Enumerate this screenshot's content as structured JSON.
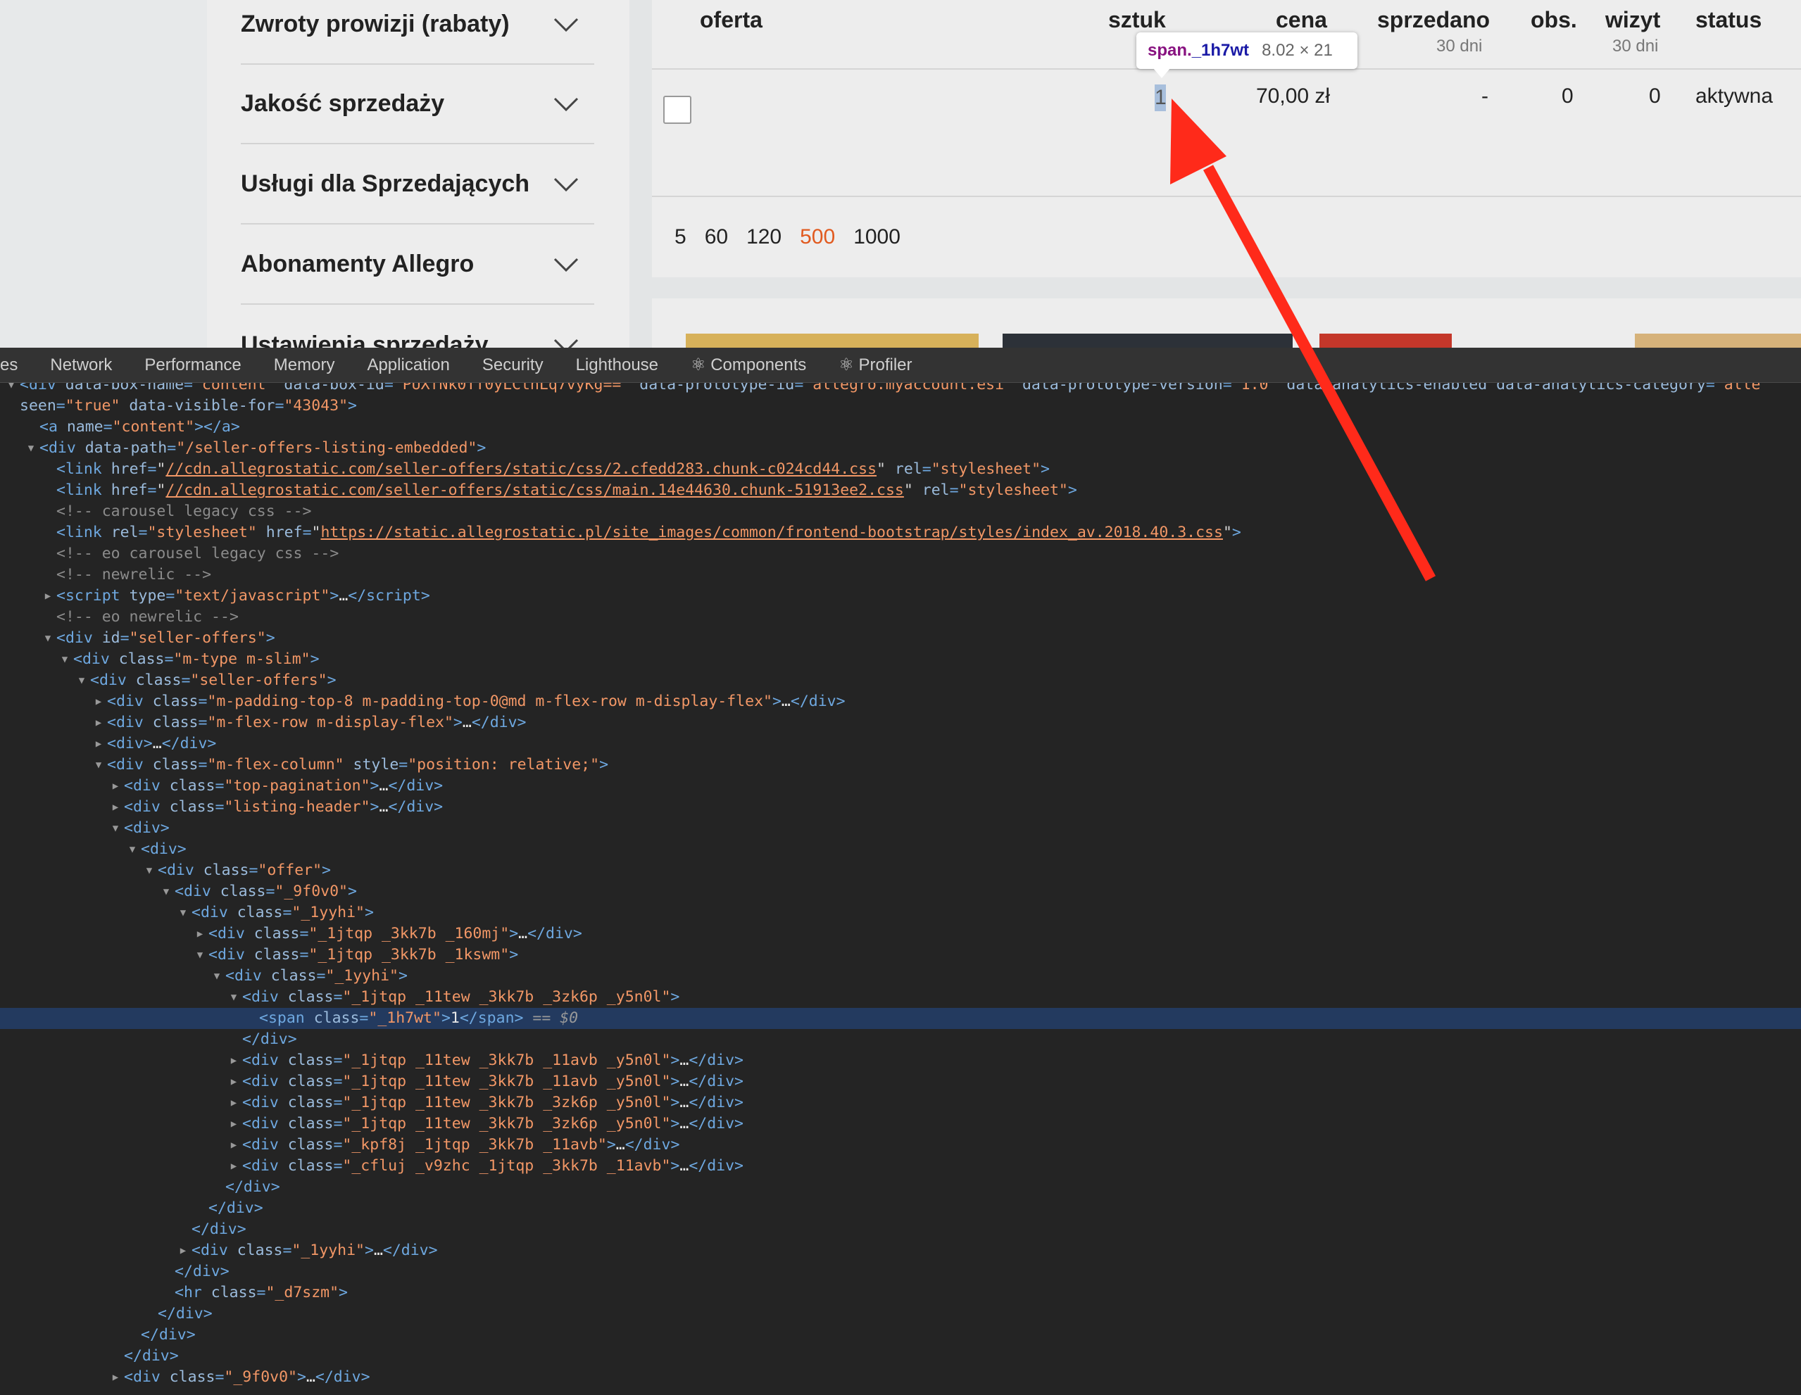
{
  "sidebar": {
    "items": [
      {
        "label": "Zwroty prowizji (rabaty)"
      },
      {
        "label": "Jakość sprzedaży"
      },
      {
        "label": "Usługi dla Sprzedających"
      },
      {
        "label": "Abonamenty Allegro"
      },
      {
        "label": "Ustawienia sprzedaży"
      }
    ]
  },
  "listing": {
    "headers": {
      "offer": "oferta",
      "qty": "sztuk",
      "price": "cena",
      "sold": "sprzedano",
      "sold_sub": "30 dni",
      "watch": "obs.",
      "visits": "wizyt",
      "visits_sub": "30 dni",
      "status": "status"
    },
    "row": {
      "qty": "1",
      "price": "70,00 zł",
      "sold": "-",
      "watch": "0",
      "visits": "0",
      "status": "aktywna"
    },
    "page_sizes": [
      "5",
      "60",
      "120",
      "500",
      "1000"
    ],
    "active_page_size": "500"
  },
  "tooltip": {
    "selector": "span.",
    "class_name": "_1h7wt",
    "size": "8.02 × 21"
  },
  "devtools": {
    "tabs": [
      "es",
      "Network",
      "Performance",
      "Memory",
      "Application",
      "Security",
      "Lighthouse",
      "⚛ Components",
      "⚛ Profiler"
    ]
  },
  "colors": {
    "accent": "#e15a1f",
    "arrow": "#ff2a1a",
    "devtools_bg": "#242424",
    "selected_row": "#233a5f"
  }
}
